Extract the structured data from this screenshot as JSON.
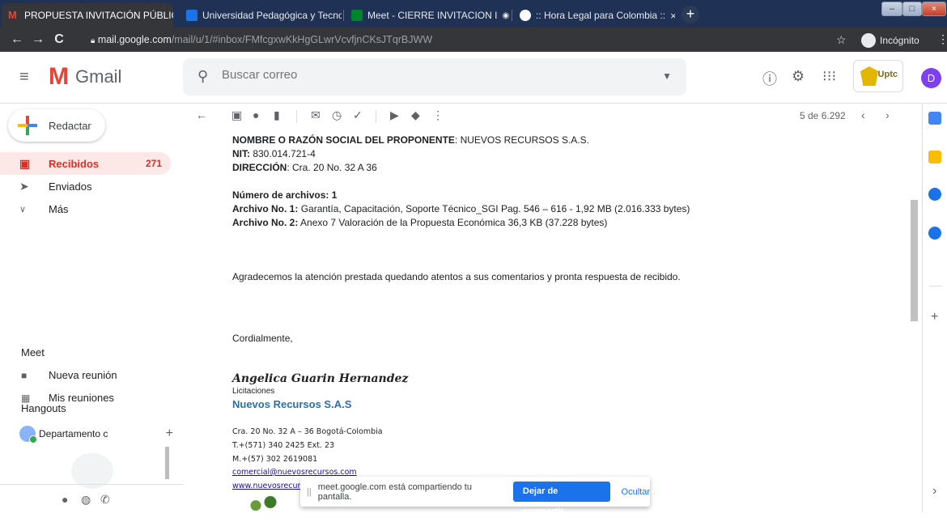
{
  "browser": {
    "tabs": [
      {
        "title": "PROPUESTA INVITACIÓN PÚBLIC",
        "close": "×",
        "favicon_color": "#ea4335",
        "active": true
      },
      {
        "title": "Universidad Pedagógica y Tecno",
        "close": "×",
        "favicon_color": "#1a73e8"
      },
      {
        "title": "Meet - CIERRE INVITACION I",
        "close": "×",
        "favicon_color": "#00832d"
      },
      {
        "title": ":: Hora Legal para Colombia ::",
        "close": "×",
        "favicon_color": "#ffffff"
      }
    ],
    "new_tab": "+",
    "back": "←",
    "forward": "→",
    "reload": "C",
    "url_host": "mail.google.com",
    "url_path": "/mail/u/1/#inbox/FMfcgxwKkHgGLwrVcvfjnCKsJTqrBJWW",
    "incognito_label": "Incógnito",
    "star": "☆",
    "menu": "⋮"
  },
  "gmail": {
    "menu_icon": "≡",
    "logo_letter": "M",
    "logo_text": "Gmail",
    "search_placeholder": "Buscar correo",
    "uptc_label": "Uptc",
    "avatar_letter": "D"
  },
  "sidebar": {
    "compose_label": "Redactar",
    "items": [
      {
        "label": "Recibidos",
        "count": "271",
        "selected": true
      },
      {
        "label": "Enviados",
        "count": ""
      },
      {
        "label": "Más",
        "count": ""
      }
    ],
    "meet_title": "Meet",
    "meet_items": [
      {
        "label": "Nueva reunión"
      },
      {
        "label": "Mis reuniones"
      }
    ],
    "hangouts_title": "Hangouts",
    "hangouts_contact": "Departamento c"
  },
  "message_toolbar": {
    "count": "5 de 6.292"
  },
  "message": {
    "proponente_label": "NOMBRE O RAZÓN SOCIAL DEL PROPONENTE",
    "proponente_value": ": NUEVOS RECURSOS S.A.S.",
    "nit_label": "NIT:",
    "nit_value": " 830.014.721-4",
    "dir_label": "DIRECCIÓN",
    "dir_value": ": Cra. 20 No. 32 A 36",
    "archivos_label": "Número de archivos: 1",
    "archivo1_label": "Archivo No. 1:",
    "archivo1_value": " Garantía, Capacitación, Soporte Técnico_SGI Pag. 546 – 616 -  1,92 MB (2.016.333 bytes)",
    "archivo2_label": "Archivo No. 2:",
    "archivo2_value": " Anexo 7 Valoración de la Propuesta Económica 36,3 KB (37.228 bytes)",
    "agradecemos": "Agradecemos la atención prestada quedando atentos a sus comentarios y pronta respuesta de recibido.",
    "cordialmente": "Cordialmente,"
  },
  "signature": {
    "name": "Angelica Guarin Hernandez",
    "role": "Licitaciones",
    "company": "Nuevos Recursos S.A.S",
    "address": "Cra. 20 No. 32 A – 36 Bogotá-Colombia",
    "phone": "T.+(571) 340 2425 Ext. 23",
    "mobile": "M.+(57)  302 2619081",
    "email": "comercial@nuevosrecursos.com",
    "web": "www.nuevosrecursos"
  },
  "share_bar": {
    "grip": "||",
    "text": "meet.google.com está compartiendo tu pantalla.",
    "stop_label": "Dejar de compartir",
    "hide_label": "Ocultar"
  }
}
